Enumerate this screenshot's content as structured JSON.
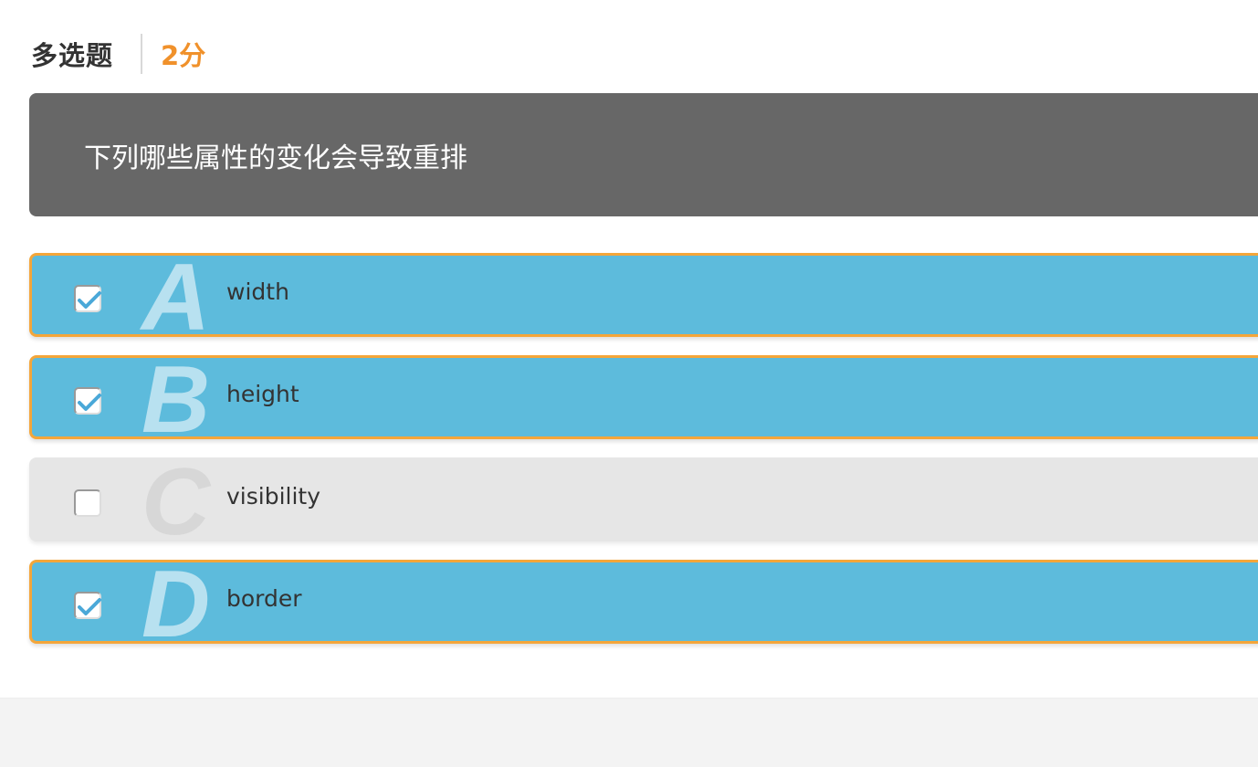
{
  "header": {
    "question_type": "多选题",
    "score": "2分"
  },
  "question": {
    "text": "下列哪些属性的变化会导致重排"
  },
  "options": [
    {
      "letter": "A",
      "text": "width",
      "checked": true
    },
    {
      "letter": "B",
      "text": "height",
      "checked": true
    },
    {
      "letter": "C",
      "text": "visibility",
      "checked": false
    },
    {
      "letter": "D",
      "text": "border",
      "checked": true
    }
  ],
  "colors": {
    "selected_bg": "#5dbbdc",
    "selected_border": "#f4a63a",
    "unselected_bg": "#e6e6e6",
    "score": "#f0912b",
    "question_bg": "#676767"
  }
}
